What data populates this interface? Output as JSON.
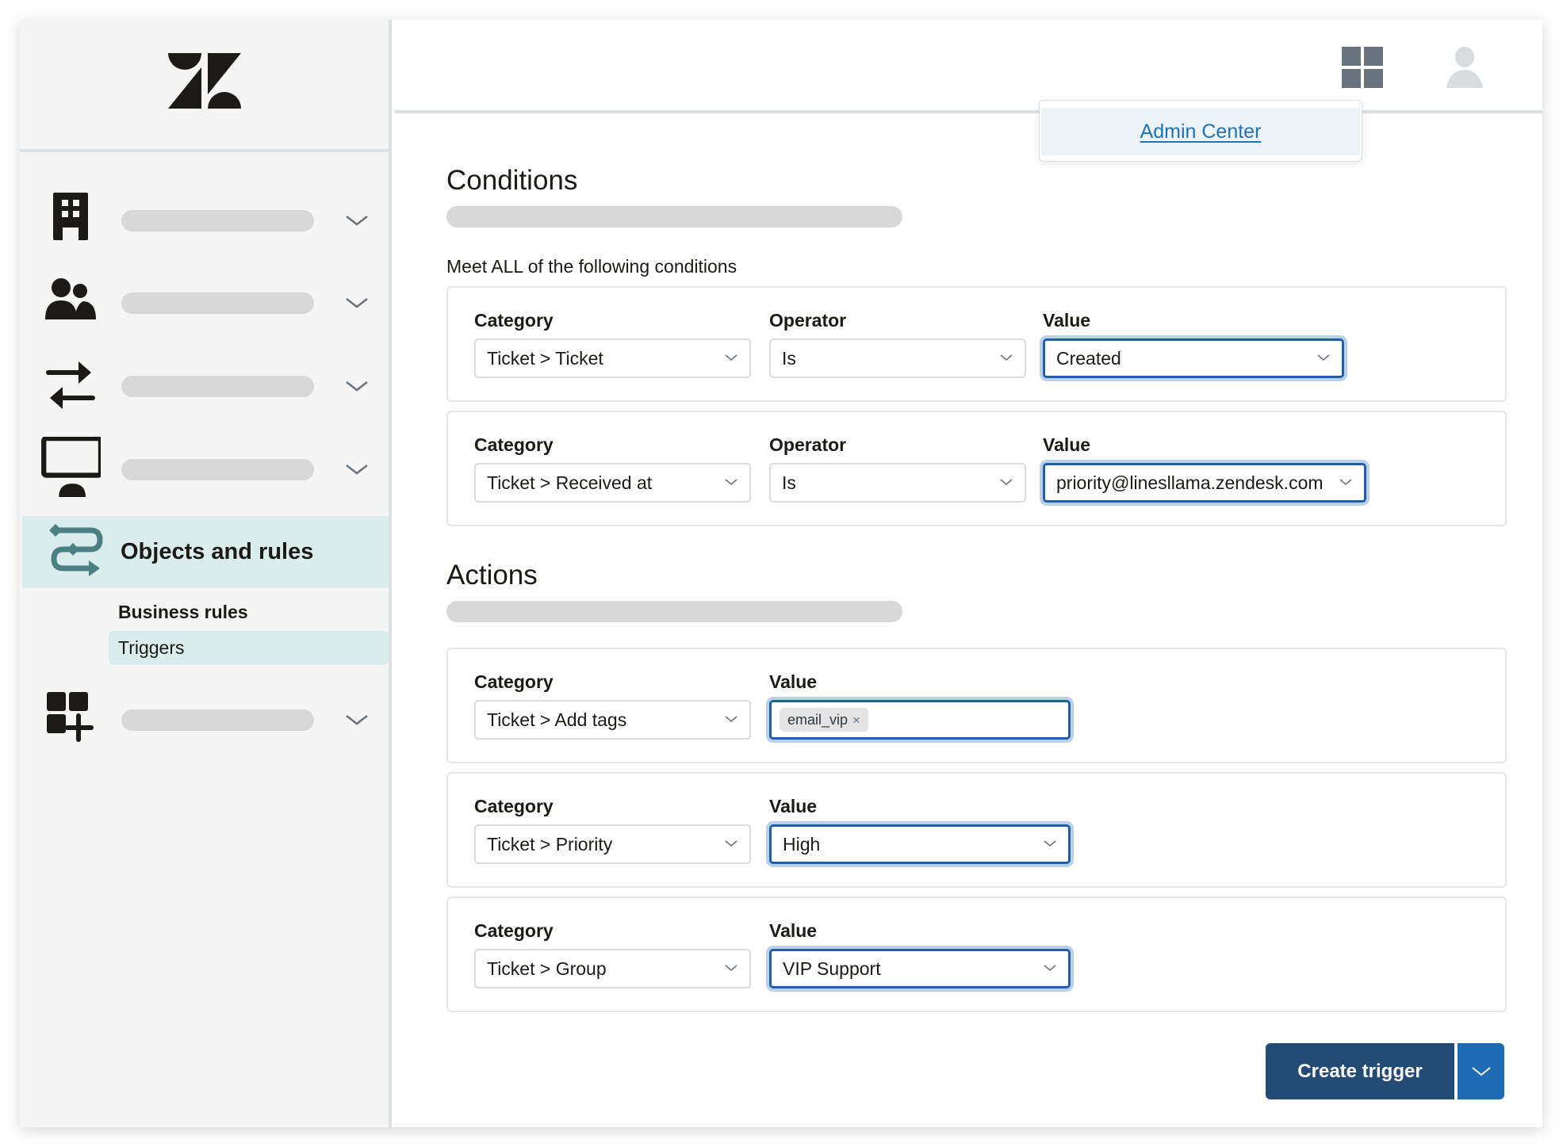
{
  "header": {
    "apps_icon": "apps-grid-icon",
    "user_icon": "user-avatar-icon",
    "popover_link": "Admin Center"
  },
  "sidebar": {
    "logo": "zendesk-logo",
    "items": [
      {
        "icon": "building-icon",
        "label": ""
      },
      {
        "icon": "people-icon",
        "label": ""
      },
      {
        "icon": "arrows-swap-icon",
        "label": ""
      },
      {
        "icon": "monitor-person-icon",
        "label": ""
      },
      {
        "icon": "objects-rules-icon",
        "label": "Objects and rules",
        "active": true
      },
      {
        "icon": "apps-add-icon",
        "label": ""
      }
    ],
    "subnav": {
      "group_label": "Business rules",
      "active_item": "Triggers"
    }
  },
  "conditions": {
    "title": "Conditions",
    "meet_label": "Meet ALL of the following conditions",
    "rows": [
      {
        "category_label": "Category",
        "category": "Ticket > Ticket",
        "operator_label": "Operator",
        "operator": "Is",
        "value_label": "Value",
        "value": "Created"
      },
      {
        "category_label": "Category",
        "category": "Ticket > Received at",
        "operator_label": "Operator",
        "operator": "Is",
        "value_label": "Value",
        "value": "priority@linesllama.zendesk.com"
      }
    ]
  },
  "actions": {
    "title": "Actions",
    "rows": [
      {
        "category_label": "Category",
        "category": "Ticket > Add tags",
        "value_label": "Value",
        "tag": "email_vip",
        "tag_remove": "×"
      },
      {
        "category_label": "Category",
        "category": "Ticket > Priority",
        "value_label": "Value",
        "value": "High"
      },
      {
        "category_label": "Category",
        "category": "Ticket > Group",
        "value_label": "Value",
        "value": "VIP Support"
      }
    ]
  },
  "footer": {
    "create_label": "Create trigger",
    "split_icon": "chevron-down-icon"
  },
  "colors": {
    "primary_dark": "#244b73",
    "primary": "#1f6bb3",
    "link": "#1f73b7",
    "active_bg": "#daecec",
    "active_icon": "#4a7f84"
  }
}
